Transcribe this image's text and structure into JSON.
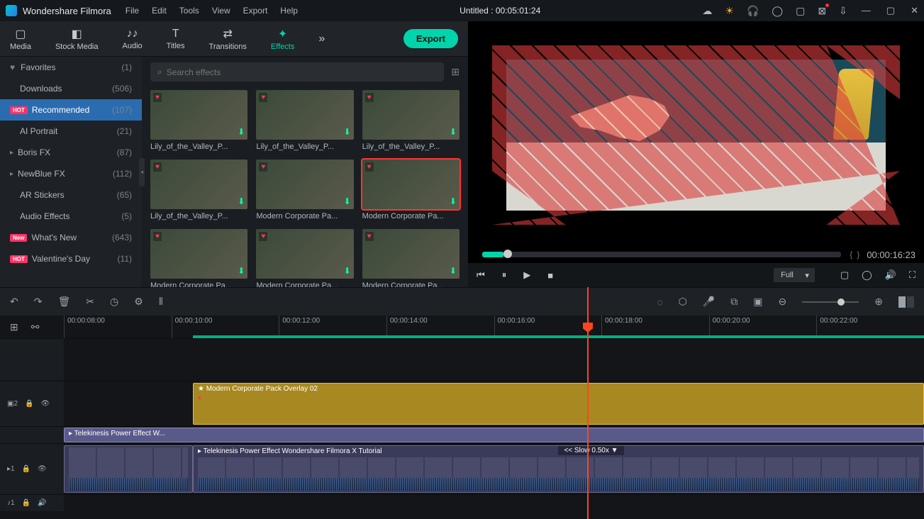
{
  "app": {
    "name": "Wondershare Filmora"
  },
  "menu": [
    "File",
    "Edit",
    "Tools",
    "View",
    "Export",
    "Help"
  ],
  "title": {
    "file": "Untitled",
    "timecode": "00:05:01:24"
  },
  "title_icons": [
    "cloud",
    "sun",
    "headphones",
    "user",
    "save",
    "mail",
    "download"
  ],
  "tabs": [
    {
      "id": "media",
      "label": "Media",
      "icon": "▢"
    },
    {
      "id": "stock",
      "label": "Stock Media",
      "icon": "◧"
    },
    {
      "id": "audio",
      "label": "Audio",
      "icon": "♪"
    },
    {
      "id": "titles",
      "label": "Titles",
      "icon": "T"
    },
    {
      "id": "transitions",
      "label": "Transitions",
      "icon": "⇄"
    },
    {
      "id": "effects",
      "label": "Effects",
      "icon": "✦",
      "active": true
    },
    {
      "id": "more",
      "label": "",
      "icon": "»"
    }
  ],
  "export_label": "Export",
  "sidebar": [
    {
      "label": "Favorites",
      "count": "(1)",
      "prefix": "heart"
    },
    {
      "label": "Downloads",
      "count": "(506)"
    },
    {
      "label": "Recommended",
      "count": "(107)",
      "badge": "HOT",
      "selected": true
    },
    {
      "label": "AI Portrait",
      "count": "(21)"
    },
    {
      "label": "Boris FX",
      "count": "(87)",
      "prefix": "arrow"
    },
    {
      "label": "NewBlue FX",
      "count": "(112)",
      "prefix": "arrow"
    },
    {
      "label": "AR Stickers",
      "count": "(65)"
    },
    {
      "label": "Audio Effects",
      "count": "(5)"
    },
    {
      "label": "What's New",
      "count": "(643)",
      "badge": "New"
    },
    {
      "label": "Valentine's Day",
      "count": "(11)",
      "badge": "HOT"
    }
  ],
  "search": {
    "placeholder": "Search effects"
  },
  "assets": [
    {
      "name": "Lily_of_the_Valley_P..."
    },
    {
      "name": "Lily_of_the_Valley_P..."
    },
    {
      "name": "Lily_of_the_Valley_P..."
    },
    {
      "name": "Lily_of_the_Valley_P..."
    },
    {
      "name": "Modern Corporate Pa..."
    },
    {
      "name": "Modern Corporate Pa...",
      "selected": true
    },
    {
      "name": "Modern Corporate Pa..."
    },
    {
      "name": "Modern Corporate Pa..."
    },
    {
      "name": "Modern Corporate Pa..."
    }
  ],
  "preview": {
    "time": "00:00:16:23",
    "view_mode": "Full"
  },
  "ruler": [
    "00:00:08:00",
    "00:00:10:00",
    "00:00:12:00",
    "00:00:14:00",
    "00:00:16:00",
    "00:00:18:00",
    "00:00:20:00",
    "00:00:22:00"
  ],
  "tracks": {
    "fx_track": {
      "id": "▣2",
      "clip": "Modern Corporate Pack Overlay 02"
    },
    "v1_upper": {
      "id": "▸1",
      "clip": "Telekinesis Power Effect   W..."
    },
    "v1_lower": {
      "clip": "Telekinesis Power Effect   Wondershare Filmora X Tutorial",
      "slow": "<< Slow 0.50x  ▼"
    },
    "audio": {
      "id": "♪1"
    }
  }
}
